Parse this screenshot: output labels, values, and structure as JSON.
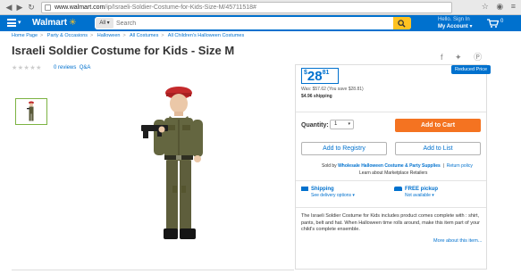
{
  "browser": {
    "url_domain": "www.walmart.com",
    "url_path": "/ip/Israeli-Soldier-Costume-for-Kids-Size-M/45711518#"
  },
  "header": {
    "logo": "Walmart",
    "search_category": "All",
    "search_placeholder": "Search",
    "account_hello": "Hello. Sign In",
    "account_label": "My Account",
    "cart_count": "0",
    "brand_color": "#0071ce",
    "accent_color": "#ffc220"
  },
  "breadcrumb": [
    "Home Page",
    "Party & Occasions",
    "Halloween",
    "All Costumes",
    "All Children's Halloween Costumes"
  ],
  "product": {
    "title": "Israeli Soldier Costume for Kids - Size M",
    "reviews_text": "0 reviews",
    "qa_text": "Q&A"
  },
  "pricing": {
    "badge": "Reduced Price",
    "currency": "$",
    "price_dollars": "28",
    "price_cents": "81",
    "was_text": "Was: $57.62 (You save $28.81)",
    "shipping_note": "$4.96 shipping"
  },
  "purchase": {
    "qty_label": "Quantity:",
    "qty_value": "1",
    "add_to_cart": "Add to Cart",
    "add_to_registry": "Add to Registry",
    "add_to_list": "Add to List",
    "sold_by_prefix": "Sold by",
    "seller": "Wholesale Halloween Costume & Party Supplies",
    "return_policy": "Return policy",
    "learn_more": "Learn about Marketplace Retailers",
    "cart_color": "#f47321"
  },
  "fulfillment": {
    "shipping_title": "Shipping",
    "shipping_sub": "See delivery options",
    "pickup_title": "FREE pickup",
    "pickup_sub": "Not available"
  },
  "description": {
    "text": "The Israeli Soldier Costume for Kids includes product comes complete with : shirt, pants, belt and hat. When Halloween time rolls around, make this item part of your child's complete ensemble.",
    "more_link": "More about this item..."
  }
}
